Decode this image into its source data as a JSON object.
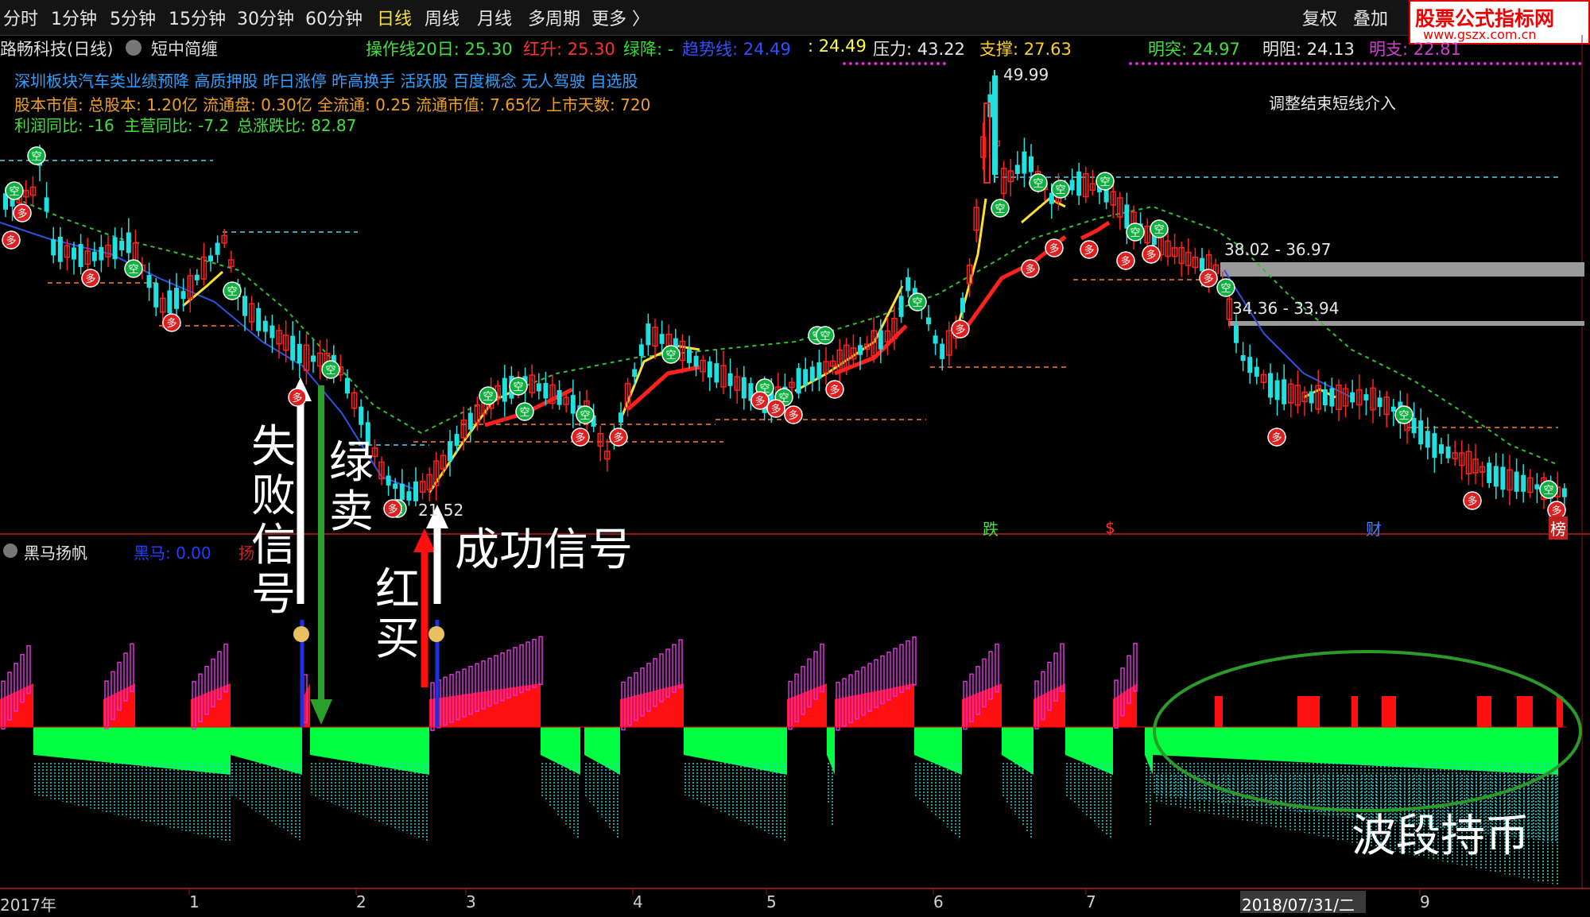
{
  "toolbar": {
    "tabs": [
      "分时",
      "1分钟",
      "5分钟",
      "15分钟",
      "30分钟",
      "60分钟",
      "日线",
      "周线",
      "月线",
      "多周期",
      "更多 〉"
    ],
    "active_tab": "日线",
    "fuquan": "复权",
    "diejia": "叠加",
    "brand_title": "股票公式指标网",
    "brand_url": "www.gszx.com.cn"
  },
  "stock": {
    "name": "路畅科技(日线)",
    "indicator": "短中简缠",
    "op_line": "操作线20日: 25.30",
    "hong_sheng": "红升: 25.30",
    "lv_jiang": "绿降: -",
    "trend": "趋势线: 24.49",
    "trend2": ": 24.49",
    "pressure": "压力: 43.22",
    "support": "支撑: 27.63",
    "ming_tu": "明突: 24.97",
    "ming_zu": "明阻: 24.13",
    "ming_zhi": "明支: 22.81"
  },
  "info": {
    "concepts": "深圳板块汽车类业绩预降 高质押股 昨日涨停 昨高换手 活跃股 百度概念 无人驾驶 自选股",
    "capital": "股本市值: 总股本: 1.20亿 流通盘: 0.30亿 全流通: 0.25 流通市值: 7.65亿 上市天数: 720",
    "profit": "利润同比: -16",
    "revenue": "主营同比: -7.2",
    "updown": "总涨跌比: 82.87",
    "note": "调整结束短线介入"
  },
  "price_labels": {
    "high": "49.99",
    "low": "21.52",
    "zone1": "38.02 - 36.97",
    "zone2": "34.36 - 33.94",
    "die": "跌",
    "dollar": "$",
    "cai": "财",
    "bang": "榜"
  },
  "signals": {
    "kong": "空",
    "duo": "多"
  },
  "lower": {
    "name": "黑马扬帆",
    "heima": "黑马: 0.00",
    "yangfan": "扬"
  },
  "annotations": {
    "fail": "失败信号",
    "green_sell": "绿卖",
    "red_buy": "红买",
    "success": "成功信号",
    "hold": "波段持币"
  },
  "xaxis": {
    "labels": [
      "2017年",
      "1",
      "2",
      "3",
      "4",
      "5",
      "6",
      "7",
      "2018/07/31/二",
      "9"
    ]
  },
  "colors": {
    "up": "#ff2020",
    "down": "#20e0e0",
    "signal_red": "#ff0000",
    "signal_green": "#00ff40",
    "magenta": "#e030e0",
    "yellow": "#ffff40"
  }
}
